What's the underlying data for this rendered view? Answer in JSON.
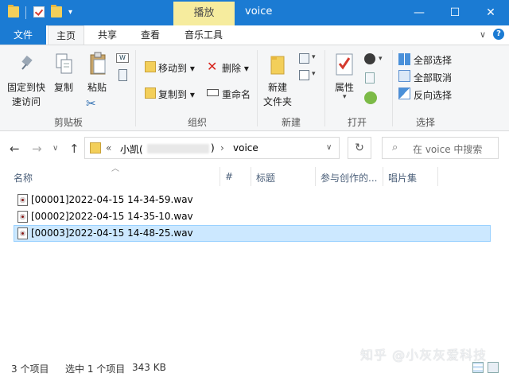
{
  "titlebar": {
    "context_tab": "播放",
    "title": "voice",
    "minimize": "—",
    "maximize": "☐",
    "close": "✕"
  },
  "tabs": {
    "file": "文件",
    "home": "主页",
    "share": "共享",
    "view": "查看",
    "music_tools": "音乐工具",
    "expand": "∨"
  },
  "ribbon": {
    "clipboard": {
      "pin_line1": "固定到快",
      "pin_line2": "速访问",
      "copy": "复制",
      "paste": "粘贴",
      "group": "剪贴板"
    },
    "organize": {
      "move_to": "移动到",
      "copy_to": "复制到",
      "delete": "删除",
      "rename": "重命名",
      "group": "组织"
    },
    "new": {
      "new_folder_line1": "新建",
      "new_folder_line2": "文件夹",
      "group": "新建"
    },
    "open": {
      "properties": "属性",
      "group": "打开"
    },
    "select": {
      "select_all": "全部选择",
      "select_none": "全部取消",
      "invert": "反向选择",
      "group": "选择"
    }
  },
  "navbar": {
    "back": "←",
    "forward": "→",
    "recent": "∨",
    "up": "↑",
    "crumb_prefix": "«",
    "crumb_parent": "小凯(",
    "crumb_parent_close": ")",
    "crumb_sep": "›",
    "crumb_current": "voice",
    "addr_drop": "∨",
    "refresh": "↻",
    "search_placeholder": "在 voice 中搜索"
  },
  "columns": {
    "name": "名称",
    "number": "#",
    "title": "标题",
    "artists": "参与创作的...",
    "album": "唱片集"
  },
  "files": [
    {
      "name": "[00001]2022-04-15 14-34-59.wav",
      "selected": false
    },
    {
      "name": "[00002]2022-04-15 14-35-10.wav",
      "selected": false
    },
    {
      "name": "[00003]2022-04-15 14-48-25.wav",
      "selected": true
    }
  ],
  "status": {
    "count": "3 个项目",
    "selected": "选中 1 个项目",
    "size": "343 KB"
  },
  "watermark": "知乎 @小灰灰爱科技",
  "colors": {
    "titlebar": "#1b7bd3",
    "context_tab": "#f6ec9e",
    "selection": "#cce8ff"
  }
}
